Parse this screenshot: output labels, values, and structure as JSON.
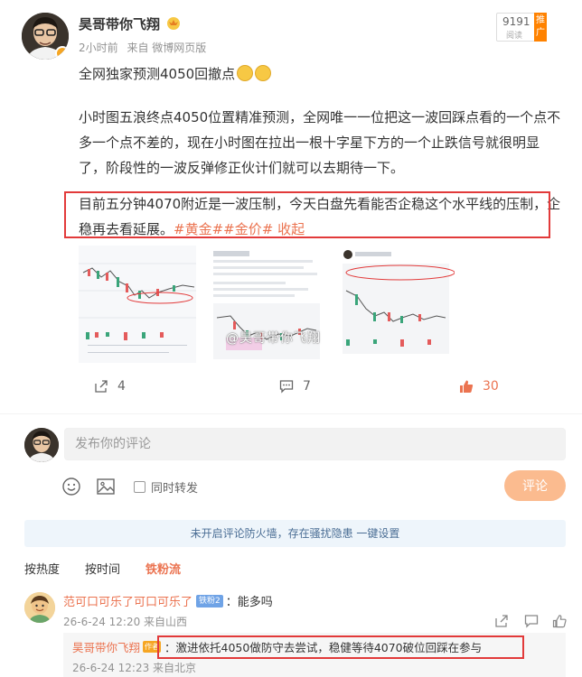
{
  "post": {
    "author": "昊哥带你飞翔",
    "time": "2小时前",
    "source": "来自 微博网页版",
    "read_count": "9191",
    "read_label": "阅读",
    "promote_tag": "推广",
    "line1": "全网独家预测4050回撤点",
    "para2": "小时图五浪终点4050位置精准预测，全网唯一一位把这一波回踩点看的一个点不多一个点不差的，现在小时图在拉出一根十字星下方的一个止跌信号就很明显了，阶段性的一波反弹修正伙计们就可以去期待一下。",
    "para3": "目前五分钟4070附近是一波压制，今天白盘先看能否企稳这个水平线的压制，企稳再去看延展。",
    "hashtag1": "#黄金#",
    "hashtag2": "#金价#",
    "collapse": "收起",
    "watermark": "@昊哥带你飞翔"
  },
  "actions": {
    "share_count": "4",
    "comment_count": "7",
    "like_count": "30"
  },
  "composer": {
    "placeholder": "发布你的评论",
    "repost_label": "同时转发",
    "submit_label": "评论"
  },
  "firewall_notice": "未开启评论防火墙，存在骚扰隐患 一键设置",
  "sort_tabs": [
    "按热度",
    "按时间",
    "铁粉流"
  ],
  "comments": [
    {
      "user": "范可口可乐了可口可乐了",
      "badge": "铁粉2",
      "text": "：能多吗",
      "meta": "26-6-24 12:20 来自山西",
      "reply": {
        "user": "昊哥带你飞翔",
        "badge": "作者",
        "text": "：激进依托4050做防守去尝试，稳健等待4070破位回踩在参与",
        "meta": "26-6-24 12:23 来自北京"
      }
    }
  ],
  "colors": {
    "accent": "#eb7350",
    "highlight_box": "#e23a3a",
    "button_disabled": "#fbbb8f",
    "notice_bg": "#eef5fb"
  }
}
